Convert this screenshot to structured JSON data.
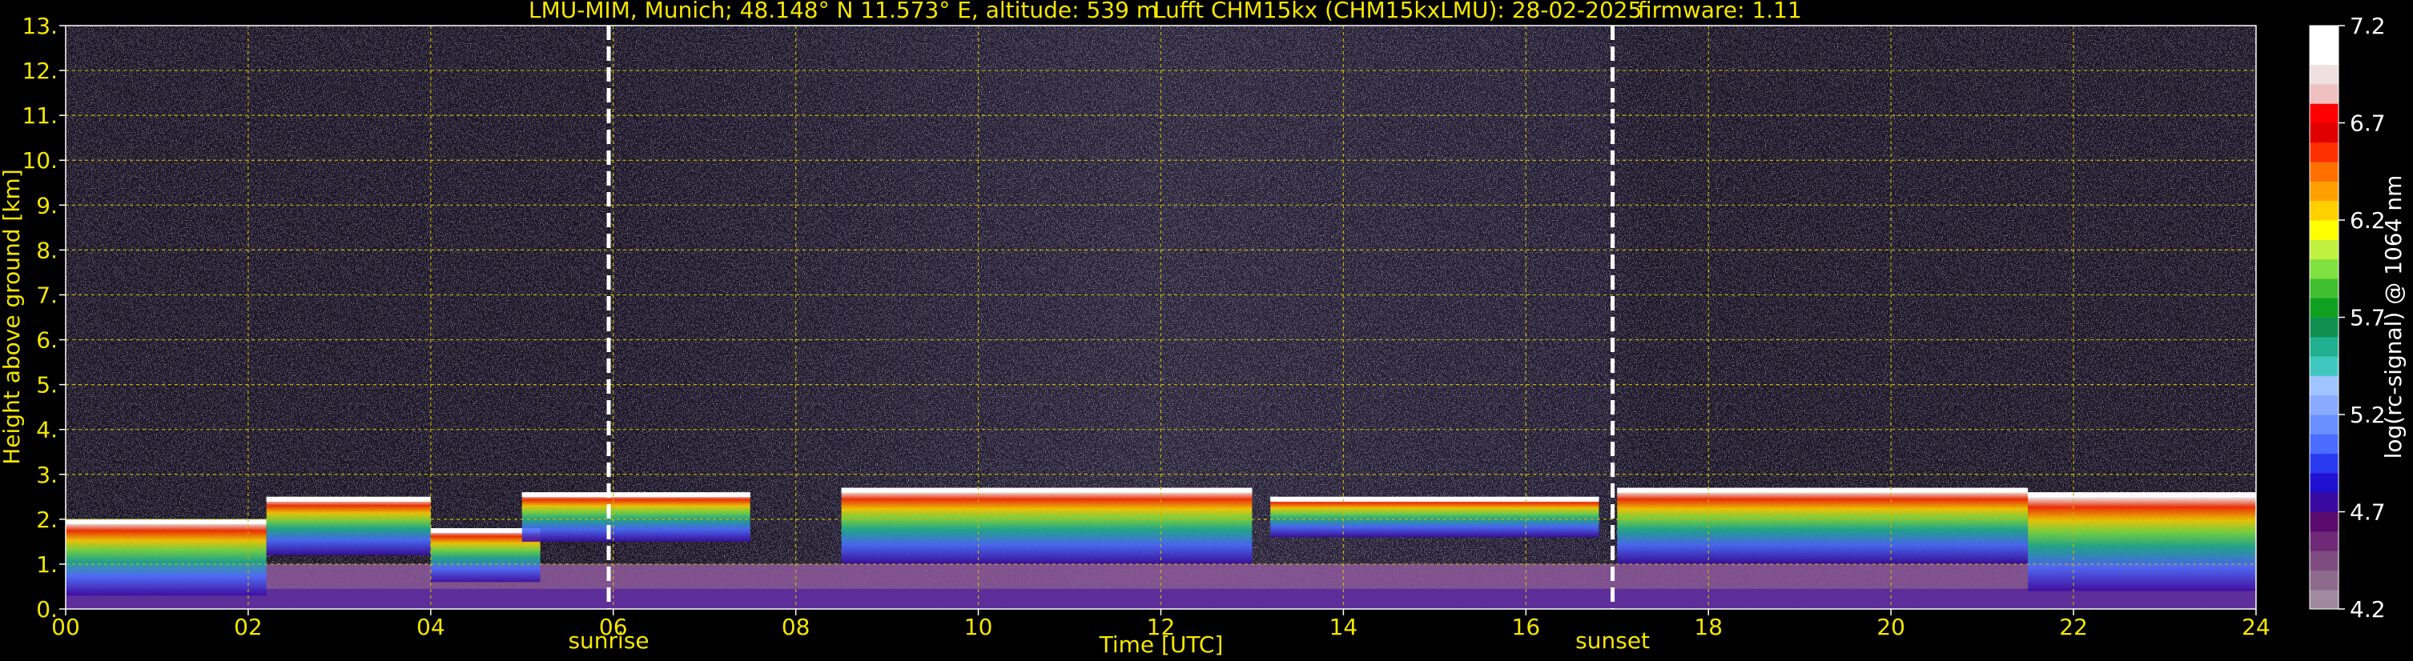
{
  "header": {
    "site": "LMU-MIM, Munich; 48.148° N 11.573° E, altitude: 539 m",
    "instrument": "Lufft CHM15kx (CHM15kxLMU): 28-02-2025",
    "firmware": "firmware: 1.11"
  },
  "chart_data": {
    "type": "heatmap",
    "title": "LMU-MIM, Munich; 48.148° N 11.573° E, altitude: 539 m    Lufft CHM15kx (CHM15kxLMU): 28-02-2025    firmware: 1.11",
    "xlabel": "Time [UTC]",
    "ylabel": "Height above ground [km]",
    "xlim": [
      0,
      24
    ],
    "ylim": [
      0,
      13
    ],
    "x_ticks": [
      "00",
      "02",
      "04",
      "06",
      "08",
      "10",
      "12",
      "14",
      "16",
      "18",
      "20",
      "22",
      "24"
    ],
    "y_ticks": [
      "0.",
      "1.",
      "2.",
      "3.",
      "4.",
      "5.",
      "6.",
      "7.",
      "8.",
      "9.",
      "10.",
      "11.",
      "12.",
      "13."
    ],
    "grid": true,
    "markers": [
      {
        "label": "sunrise",
        "time": 5.95
      },
      {
        "label": "sunset",
        "time": 16.95
      }
    ],
    "colorbar": {
      "label": "log(rc-signal) @ 1064 nm",
      "range": [
        4.2,
        7.2
      ],
      "ticks": [
        "4.2",
        "4.7",
        "5.2",
        "5.7",
        "6.2",
        "6.7",
        "7.2"
      ],
      "colors": [
        "#a08aa0",
        "#8e6a8e",
        "#7e4c80",
        "#6e2a76",
        "#5a0a6c",
        "#3a0aa0",
        "#2010d0",
        "#2a3af0",
        "#4a6cff",
        "#6a90ff",
        "#8aaaff",
        "#a0c4ff",
        "#40c8c0",
        "#20b090",
        "#109050",
        "#10a020",
        "#40c030",
        "#80e040",
        "#c0f040",
        "#ffff00",
        "#ffd000",
        "#ffa000",
        "#ff7000",
        "#ff3000",
        "#e00000",
        "#ff0000",
        "#f0c0c0",
        "#f0e0e0",
        "#ffffff",
        "#ffffff"
      ]
    },
    "cloud_base_km": [
      {
        "x0": 0.0,
        "x1": 2.2,
        "base": 0.3,
        "top": 2.0
      },
      {
        "x0": 2.2,
        "x1": 4.0,
        "base": 1.2,
        "top": 2.5
      },
      {
        "x0": 4.0,
        "x1": 5.2,
        "base": 0.6,
        "top": 1.8
      },
      {
        "x0": 5.0,
        "x1": 7.5,
        "base": 1.5,
        "top": 2.6
      },
      {
        "x0": 8.5,
        "x1": 13.0,
        "base": 1.0,
        "top": 2.7
      },
      {
        "x0": 13.2,
        "x1": 16.8,
        "base": 1.6,
        "top": 2.5
      },
      {
        "x0": 17.0,
        "x1": 21.5,
        "base": 1.0,
        "top": 2.7
      },
      {
        "x0": 21.5,
        "x1": 24.0,
        "base": 0.4,
        "top": 2.6
      }
    ],
    "colors": {
      "axis_text": "#f5e600",
      "grid": "#c8b400",
      "background": "#1a1428",
      "marker": "#ffffff"
    }
  }
}
